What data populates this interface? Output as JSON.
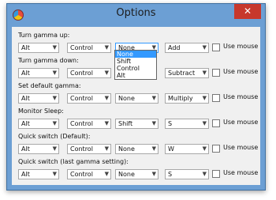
{
  "window": {
    "title": "Options",
    "close_glyph": "✕"
  },
  "sections": [
    {
      "label": "Turn gamma up:",
      "values": [
        "Alt",
        "Control",
        "None",
        "Add"
      ],
      "use_mouse": "Use mouse"
    },
    {
      "label": "Turn gamma down:",
      "values": [
        "Alt",
        "Control",
        "None",
        "Subtract"
      ],
      "use_mouse": "Use mouse"
    },
    {
      "label": "Set default gamma:",
      "values": [
        "Alt",
        "Control",
        "None",
        "Multiply"
      ],
      "use_mouse": "Use mouse"
    },
    {
      "label": "Monitor Sleep:",
      "values": [
        "Alt",
        "Control",
        "Shift",
        "S"
      ],
      "use_mouse": "Use mouse"
    },
    {
      "label": "Quick switch (Default):",
      "values": [
        "Alt",
        "Control",
        "None",
        "W"
      ],
      "use_mouse": "Use mouse"
    },
    {
      "label": "Quick switch (last gamma setting):",
      "values": [
        "Alt",
        "Control",
        "None",
        "S"
      ],
      "use_mouse": "Use mouse"
    }
  ],
  "open_dropdown": {
    "options": [
      "None",
      "Shift",
      "Control",
      "Alt"
    ],
    "selected": "None"
  },
  "colors": {
    "titlebar": "#6c9fd4",
    "close": "#c7382c",
    "selection": "#3399ff"
  },
  "icons": {
    "app": "app-icon",
    "close": "close-icon",
    "arrow": "chevron-down-icon"
  }
}
